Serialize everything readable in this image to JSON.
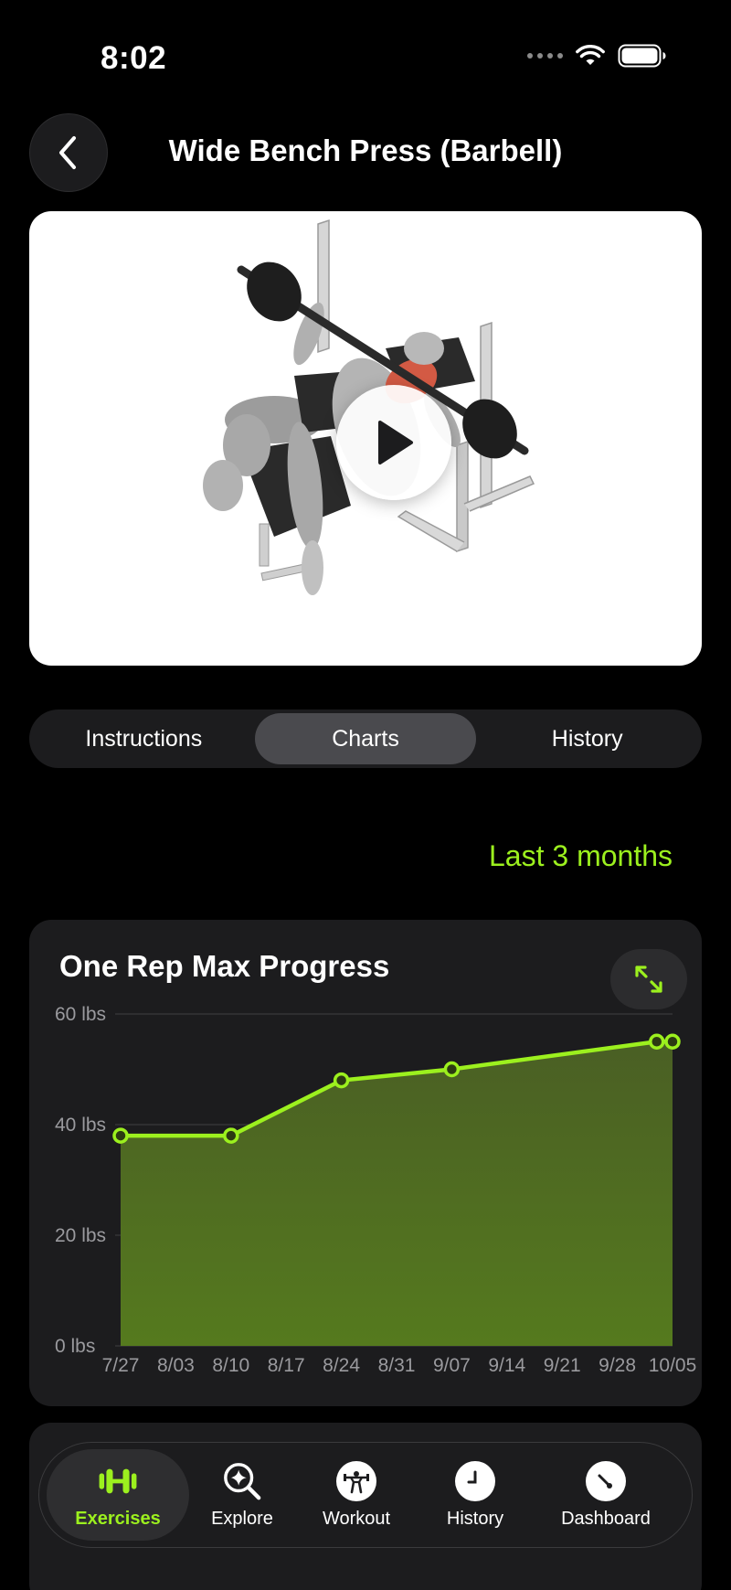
{
  "status_bar": {
    "time": "8:02"
  },
  "header": {
    "title": "Wide Bench Press (Barbell)"
  },
  "tabs": [
    {
      "label": "Instructions",
      "active": false
    },
    {
      "label": "Charts",
      "active": true
    },
    {
      "label": "History",
      "active": false
    }
  ],
  "range_selector": {
    "label": "Last 3 months"
  },
  "chart_card": {
    "title": "One Rep Max Progress"
  },
  "chart_data": {
    "type": "area",
    "title": "One Rep Max Progress",
    "x_ticks": [
      "7/27",
      "8/03",
      "8/10",
      "8/17",
      "8/24",
      "8/31",
      "9/07",
      "9/14",
      "9/21",
      "9/28",
      "10/05"
    ],
    "y_ticks": [
      "0 lbs",
      "20 lbs",
      "40 lbs",
      "60 lbs"
    ],
    "ylim": [
      0,
      60
    ],
    "series": [
      {
        "x": [
          "7/27",
          "8/10",
          "8/24",
          "9/07",
          "10/03",
          "10/05"
        ],
        "values": [
          38,
          38,
          48,
          50,
          55,
          55
        ]
      }
    ],
    "grid": true,
    "line_color": "#9cf01e",
    "fill_color": "#4d6b1c"
  },
  "tab_bar": {
    "items": [
      {
        "label": "Exercises",
        "icon": "dumbbell-icon",
        "active": true
      },
      {
        "label": "Explore",
        "icon": "sparkle-search-icon",
        "active": false
      },
      {
        "label": "Workout",
        "icon": "lifter-icon",
        "active": false
      },
      {
        "label": "History",
        "icon": "clock-icon",
        "active": false
      },
      {
        "label": "Dashboard",
        "icon": "gauge-icon",
        "active": false
      }
    ]
  },
  "colors": {
    "accent": "#9cf01e",
    "background": "#000000",
    "card": "#1c1c1e"
  }
}
